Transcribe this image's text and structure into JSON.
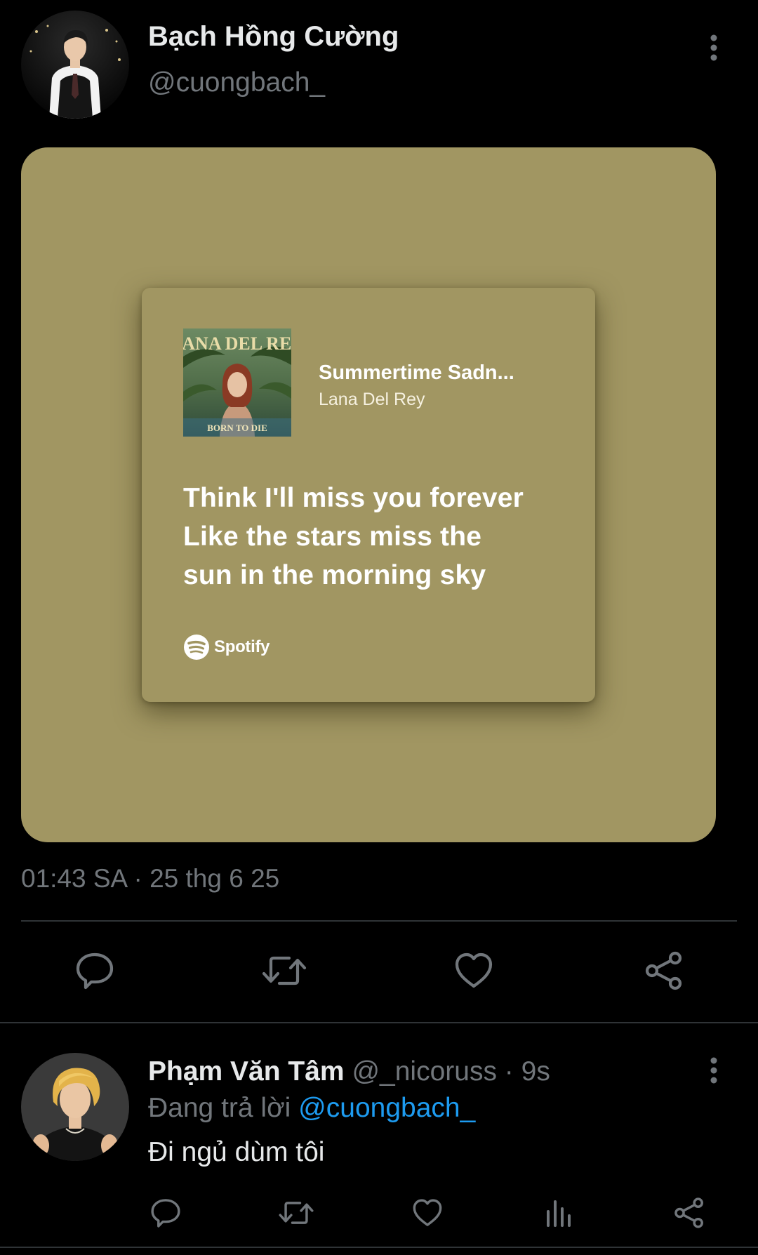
{
  "tweet": {
    "author": {
      "display_name": "Bạch Hồng Cường",
      "handle": "@cuongbach_"
    },
    "media": {
      "song_title": "Summertime Sadn...",
      "artist": "Lana Del Rey",
      "album_art_text": {
        "top": "LANA DEL REY",
        "bottom": "BORN TO DIE"
      },
      "lyrics": [
        "Think I'll miss you forever",
        "Like the stars miss the",
        "sun in the morning sky"
      ],
      "brand": "Spotify",
      "background_color": "#a19662"
    },
    "timestamp": "01:43 SA · 25 thg 6 25",
    "actions": [
      "reply-icon",
      "retweet-icon",
      "like-icon",
      "share-icon"
    ]
  },
  "reply": {
    "author": {
      "display_name": "Phạm Văn Tâm",
      "handle": "@_nicoruss",
      "time_separator": "·",
      "time": "9s"
    },
    "replying_to_label": "Đang trả lời",
    "replying_to_handle": "@cuongbach_",
    "text": "Đi ngủ dùm tôi",
    "actions": [
      "reply-icon",
      "retweet-icon",
      "like-icon",
      "views-icon",
      "share-icon"
    ]
  },
  "colors": {
    "background": "#000000",
    "primary_text": "#e7e9ea",
    "secondary_text": "#71767b",
    "link": "#1d9bf0",
    "divider": "#2f3336"
  }
}
